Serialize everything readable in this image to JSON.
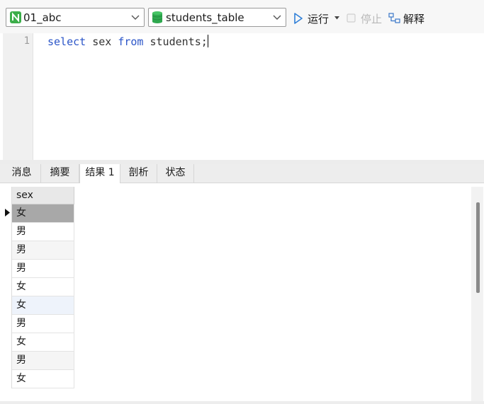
{
  "toolbar": {
    "connection": {
      "value": "01_abc",
      "icon": "connection-icon",
      "color": "#3cae4a"
    },
    "database": {
      "value": "students_table",
      "icon": "database-icon",
      "color": "#2fa84f"
    },
    "run_label": "运行",
    "stop_label": "停止",
    "explain_label": "解释"
  },
  "editor": {
    "lines": [
      {
        "number": "1",
        "tokens": [
          "select",
          " sex ",
          "from",
          " students;"
        ]
      }
    ],
    "keyword_color": "#2b55c8"
  },
  "result_tabs": [
    {
      "label": "消息"
    },
    {
      "label": "摘要"
    },
    {
      "label": "结果 1",
      "active": true
    },
    {
      "label": "剖析"
    },
    {
      "label": "状态"
    }
  ],
  "result_grid": {
    "columns": [
      "sex"
    ],
    "rows": [
      "女",
      "男",
      "男",
      "男",
      "女",
      "女",
      "男",
      "女",
      "男",
      "女"
    ],
    "selected_row": 0
  }
}
